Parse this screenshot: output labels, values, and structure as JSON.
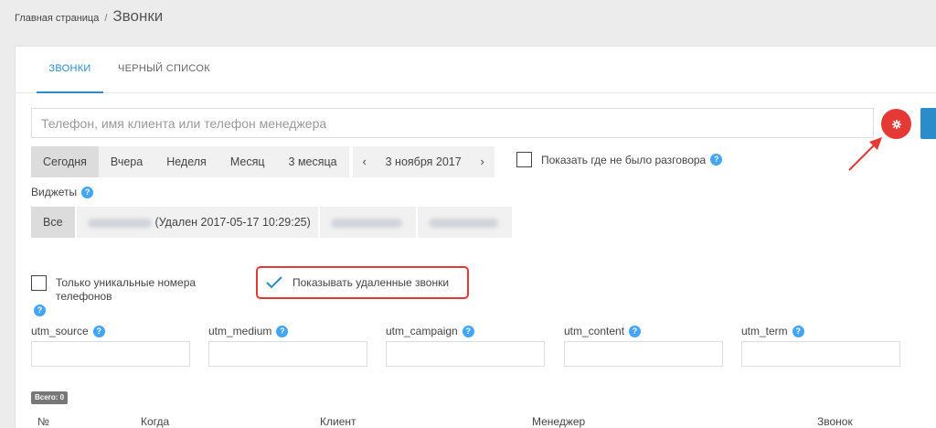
{
  "breadcrumb": {
    "home": "Главная страница",
    "separator": "/",
    "current": "Звонки"
  },
  "tabs": [
    {
      "label": "ЗВОНКИ"
    },
    {
      "label": "ЧЕРНЫЙ СПИСОК"
    }
  ],
  "search": {
    "placeholder": "Телефон, имя клиента или телефон менеджера"
  },
  "periods": [
    "Сегодня",
    "Вчера",
    "Неделя",
    "Месяц",
    "3 месяца"
  ],
  "date_nav": {
    "prev": "‹",
    "date": "3 ноября 2017",
    "next": "›"
  },
  "no_talk_label": "Показать где не было разговора",
  "widgets": {
    "label": "Виджеты",
    "all": "Все",
    "deleted_suffix": "(Удален 2017-05-17 10:29:25)"
  },
  "unique_label": "Только уникальные номера телефонов",
  "deleted_label": "Показывать удаленные звонки",
  "utm": [
    "utm_source",
    "utm_medium",
    "utm_campaign",
    "utm_content",
    "utm_term"
  ],
  "total_badge": "Всего: 0",
  "table_headers": [
    "№",
    "Когда",
    "Клиент",
    "Менеджер",
    "Звонок"
  ],
  "colors": {
    "accent": "#2a8cc8",
    "danger": "#e53935",
    "help": "#42a5f5"
  }
}
